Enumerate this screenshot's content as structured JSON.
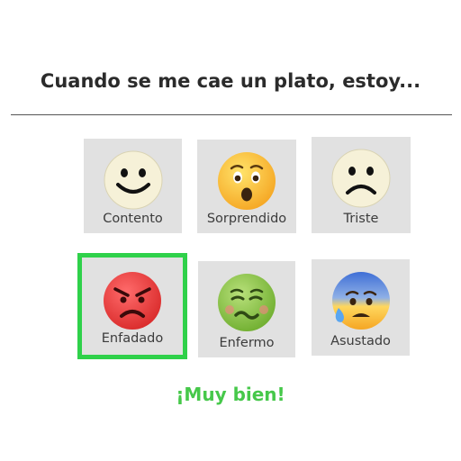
{
  "question": "Cuando se me cae un plato, estoy...",
  "options": [
    {
      "label": "Contento",
      "icon": "smiling-face-icon"
    },
    {
      "label": "Sorprendido",
      "icon": "surprised-face-icon"
    },
    {
      "label": "Triste",
      "icon": "frowning-face-icon"
    },
    {
      "label": "Enfadado",
      "icon": "angry-face-icon",
      "selected": true
    },
    {
      "label": "Enfermo",
      "icon": "nauseated-face-icon"
    },
    {
      "label": "Asustado",
      "icon": "anxious-face-with-sweat-icon"
    }
  ],
  "feedback": "¡Muy bien!",
  "colors": {
    "selected_border": "#2fd14a",
    "feedback_text": "#46c84a",
    "card_bg": "#e1e1e1"
  }
}
